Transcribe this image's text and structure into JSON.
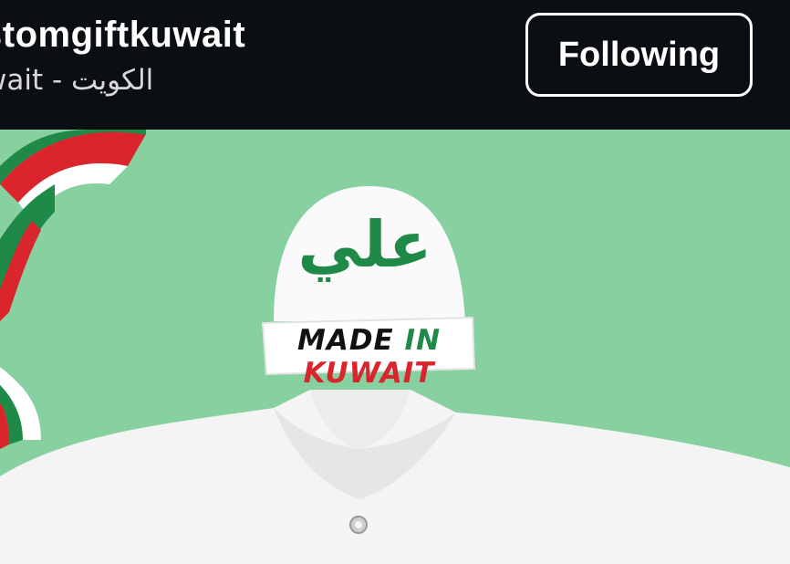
{
  "profile": {
    "username": "stomgiftkuwait",
    "location": "wait - الكويت",
    "follow_button_label": "Following"
  },
  "photo": {
    "hat_name": "علي",
    "band_words": [
      "MADE",
      "IN",
      "KUWAIT"
    ]
  },
  "colors": {
    "header_bg": "#0b0f13",
    "photo_bg": "#86d19f",
    "green": "#1f8a47",
    "red": "#d9252b"
  }
}
